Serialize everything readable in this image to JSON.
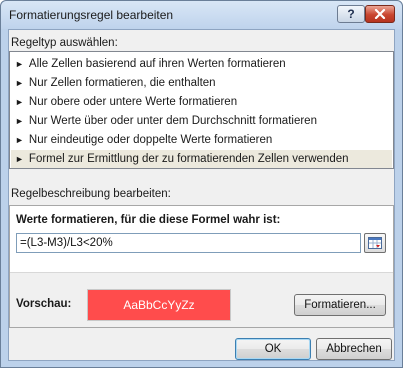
{
  "window": {
    "title": "Formatierungsregel bearbeiten",
    "help_glyph": "?"
  },
  "rule_type": {
    "label": "Regeltyp auswählen:",
    "items": [
      {
        "label": "Alle Zellen basierend auf ihren Werten formatieren",
        "selected": false
      },
      {
        "label": "Nur Zellen formatieren, die enthalten",
        "selected": false
      },
      {
        "label": "Nur obere oder untere Werte formatieren",
        "selected": false
      },
      {
        "label": "Nur Werte über oder unter dem Durchschnitt formatieren",
        "selected": false
      },
      {
        "label": "Nur eindeutige oder doppelte Werte formatieren",
        "selected": false
      },
      {
        "label": "Formel zur Ermittlung der zu formatierenden Zellen verwenden",
        "selected": true
      }
    ],
    "arrow_glyph": "►"
  },
  "description": {
    "label": "Regelbeschreibung bearbeiten:",
    "heading": "Werte formatieren, für die diese Formel wahr ist:",
    "formula_value": "=(L3-M3)/L3<20%",
    "preview_label": "Vorschau:",
    "preview_text": "AaBbCcYyZz",
    "preview_color": "#ff4c4c",
    "format_button": "Formatieren..."
  },
  "buttons": {
    "ok": "OK",
    "cancel": "Abbrechen"
  },
  "icons": {
    "close": "close-icon",
    "collapse": "collapse-dialog-icon",
    "list_arrow": "triangle-right-icon"
  }
}
